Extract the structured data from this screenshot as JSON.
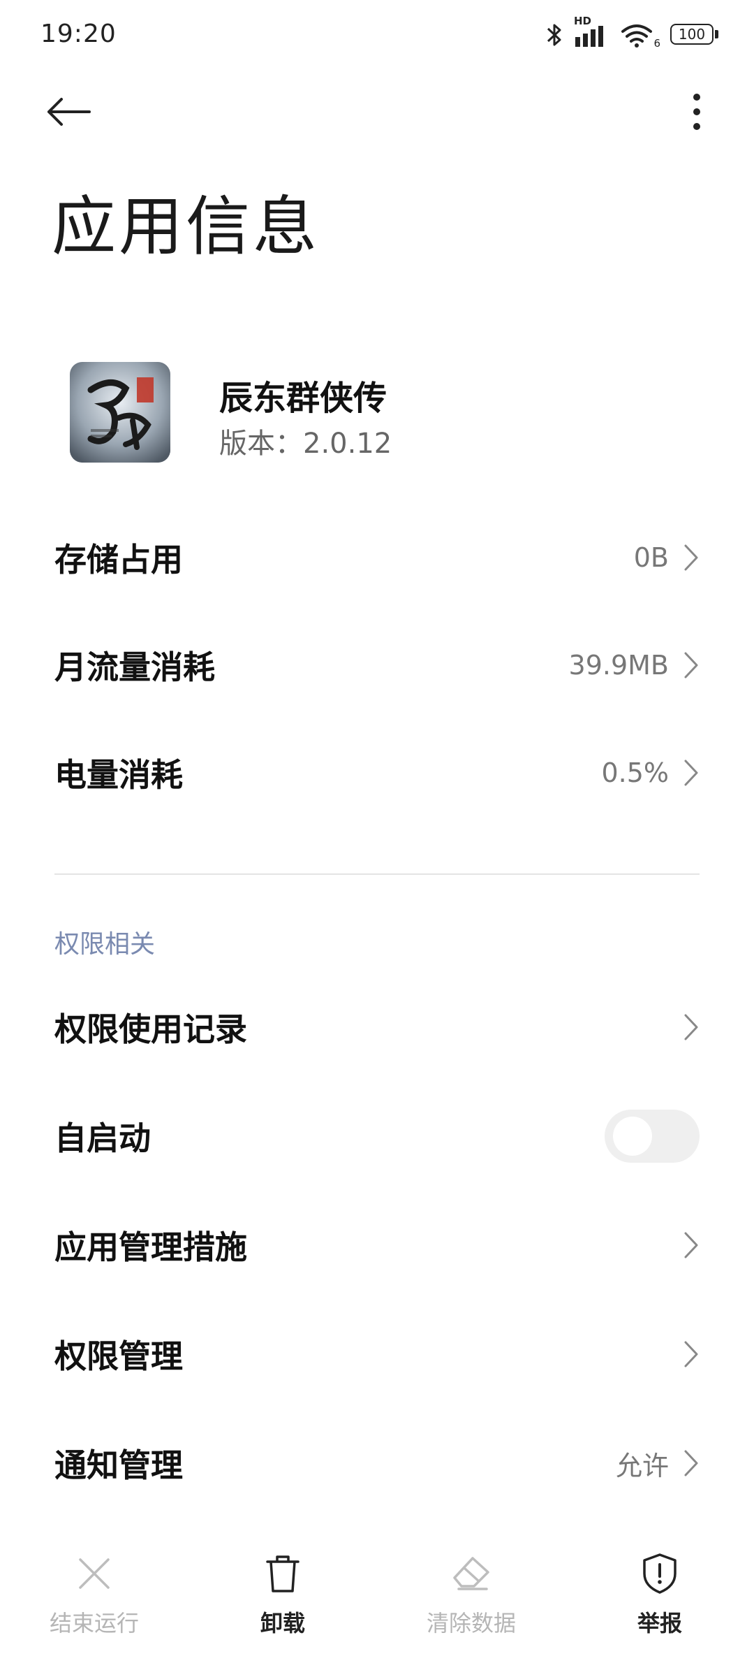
{
  "status_bar": {
    "time": "19:20",
    "battery": "100",
    "hd_label": "HD",
    "wifi_sub": "6",
    "icons": [
      "bluetooth-icon",
      "signal-icon",
      "wifi-icon",
      "battery-icon"
    ]
  },
  "header": {
    "title": "应用信息",
    "back_icon": "arrow-left-icon",
    "more_icon": "more-vertical-icon"
  },
  "app": {
    "name": "辰东群侠传",
    "version": "版本：2.0.12"
  },
  "usage_rows": [
    {
      "label": "存储占用",
      "value": "0B"
    },
    {
      "label": "月流量消耗",
      "value": "39.9MB"
    },
    {
      "label": "电量消耗",
      "value": "0.5%"
    }
  ],
  "permissions": {
    "section_title": "权限相关",
    "rows": [
      {
        "label": "权限使用记录",
        "value": ""
      },
      {
        "label": "自启动",
        "toggle": false
      },
      {
        "label": "应用管理措施",
        "value": ""
      },
      {
        "label": "权限管理",
        "value": ""
      },
      {
        "label": "通知管理",
        "value": "允许"
      }
    ]
  },
  "bottom_bar": [
    {
      "label": "结束运行",
      "icon": "close-icon",
      "enabled": false
    },
    {
      "label": "卸载",
      "icon": "trash-icon",
      "enabled": true
    },
    {
      "label": "清除数据",
      "icon": "eraser-icon",
      "enabled": false
    },
    {
      "label": "举报",
      "icon": "shield-alert-icon",
      "enabled": true
    }
  ],
  "colors": {
    "accent_section": "#7a8ab0",
    "disabled": "#b5b5b5",
    "text": "#111111"
  }
}
